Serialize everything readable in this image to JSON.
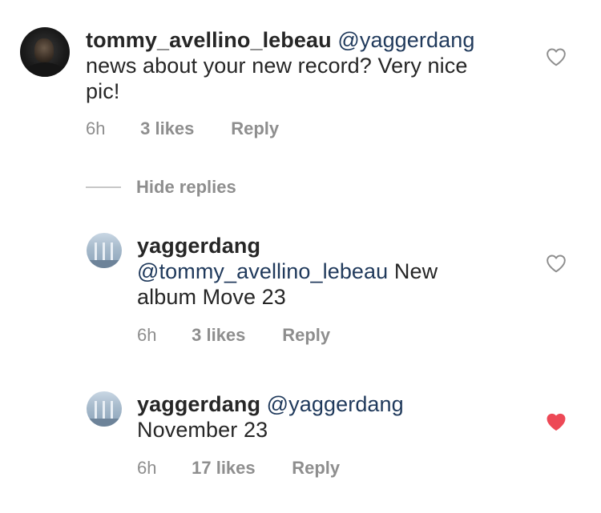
{
  "comments": [
    {
      "username": "tommy_avellino_lebeau",
      "mention": "@yaggerdang",
      "text_line1": "news about your new record? Very nice",
      "text_line2": "pic!",
      "time": "6h",
      "likes": "3 likes",
      "reply": "Reply",
      "liked": false
    }
  ],
  "hide_replies_label": "Hide replies",
  "replies": [
    {
      "username": "yaggerdang",
      "mention": "@tommy_avellino_lebeau",
      "text_after_mention": "New",
      "text_line2": "album Move 23",
      "time": "6h",
      "likes": "3 likes",
      "reply": "Reply",
      "liked": false
    },
    {
      "username": "yaggerdang",
      "mention": "@yaggerdang",
      "text_line2": "November 23",
      "time": "6h",
      "likes": "17 likes",
      "reply": "Reply",
      "liked": true
    }
  ],
  "colors": {
    "liked_heart": "#ed4956",
    "unliked_heart_stroke": "#8e8e8e",
    "mention": "#203a5c",
    "meta": "#8e8e8e"
  },
  "icons": {
    "heart_outline": "heart-outline-icon",
    "heart_filled": "heart-filled-icon"
  }
}
